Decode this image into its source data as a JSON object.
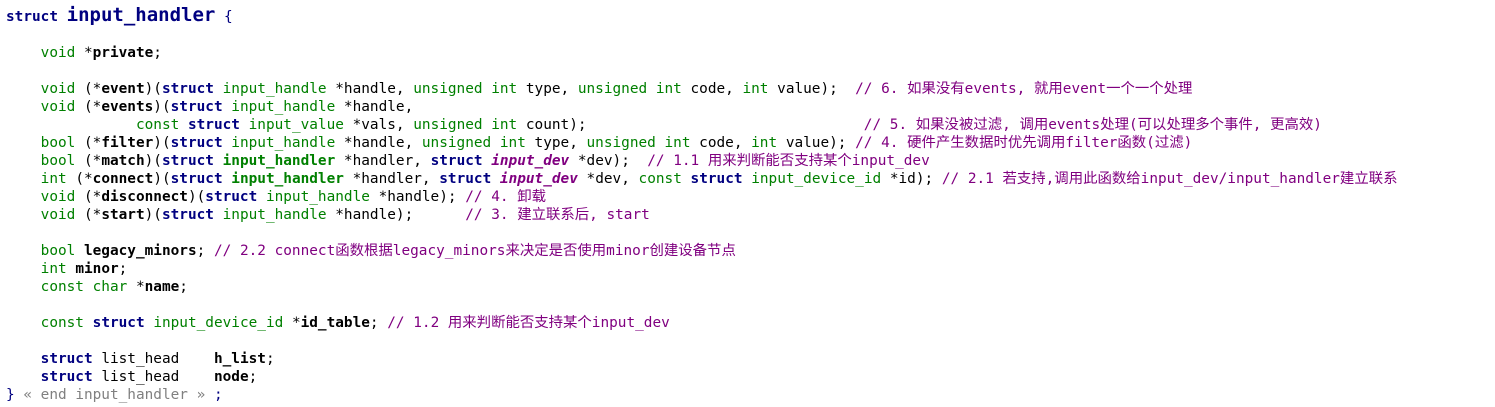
{
  "editor": {
    "lines": [
      [
        {
          "t": "struct ",
          "c": "sk"
        },
        {
          "t": "input_handler",
          "c": "title"
        },
        {
          "t": " {",
          "c": "brace"
        }
      ],
      [],
      [
        {
          "t": "    ",
          "c": "p"
        },
        {
          "t": "void",
          "c": "kw"
        },
        {
          "t": " *",
          "c": "p"
        },
        {
          "t": "private",
          "c": "fn"
        },
        {
          "t": ";",
          "c": "p"
        }
      ],
      [],
      [
        {
          "t": "    ",
          "c": "p"
        },
        {
          "t": "void",
          "c": "kw"
        },
        {
          "t": " (*",
          "c": "p"
        },
        {
          "t": "event",
          "c": "fn"
        },
        {
          "t": ")(",
          "c": "p"
        },
        {
          "t": "struct",
          "c": "sk"
        },
        {
          "t": " ",
          "c": "p"
        },
        {
          "t": "input_handle",
          "c": "ty"
        },
        {
          "t": " *",
          "c": "p"
        },
        {
          "t": "handle",
          "c": "id"
        },
        {
          "t": ", ",
          "c": "p"
        },
        {
          "t": "unsigned int",
          "c": "kw"
        },
        {
          "t": " ",
          "c": "p"
        },
        {
          "t": "type",
          "c": "id"
        },
        {
          "t": ", ",
          "c": "p"
        },
        {
          "t": "unsigned int",
          "c": "kw"
        },
        {
          "t": " ",
          "c": "p"
        },
        {
          "t": "code",
          "c": "id"
        },
        {
          "t": ", ",
          "c": "p"
        },
        {
          "t": "int",
          "c": "kw"
        },
        {
          "t": " ",
          "c": "p"
        },
        {
          "t": "value",
          "c": "id"
        },
        {
          "t": ");  ",
          "c": "p"
        },
        {
          "t": "// 6. 如果没有events, 就用event一个一个处理",
          "c": "cm"
        }
      ],
      [
        {
          "t": "    ",
          "c": "p"
        },
        {
          "t": "void",
          "c": "kw"
        },
        {
          "t": " (*",
          "c": "p"
        },
        {
          "t": "events",
          "c": "fn"
        },
        {
          "t": ")(",
          "c": "p"
        },
        {
          "t": "struct",
          "c": "sk"
        },
        {
          "t": " ",
          "c": "p"
        },
        {
          "t": "input_handle",
          "c": "ty"
        },
        {
          "t": " *",
          "c": "p"
        },
        {
          "t": "handle",
          "c": "id"
        },
        {
          "t": ",",
          "c": "p"
        }
      ],
      [
        {
          "t": "               ",
          "c": "p"
        },
        {
          "t": "const",
          "c": "kw"
        },
        {
          "t": " ",
          "c": "p"
        },
        {
          "t": "struct",
          "c": "sk"
        },
        {
          "t": " ",
          "c": "p"
        },
        {
          "t": "input_value",
          "c": "ty"
        },
        {
          "t": " *",
          "c": "p"
        },
        {
          "t": "vals",
          "c": "id"
        },
        {
          "t": ", ",
          "c": "p"
        },
        {
          "t": "unsigned int",
          "c": "kw"
        },
        {
          "t": " ",
          "c": "p"
        },
        {
          "t": "count",
          "c": "id"
        },
        {
          "t": ");                                ",
          "c": "p"
        },
        {
          "t": "// 5. 如果没被过滤, 调用events处理(可以处理多个事件, 更高效)",
          "c": "cm"
        }
      ],
      [
        {
          "t": "    ",
          "c": "p"
        },
        {
          "t": "bool",
          "c": "kw"
        },
        {
          "t": " (*",
          "c": "p"
        },
        {
          "t": "filter",
          "c": "fn"
        },
        {
          "t": ")(",
          "c": "p"
        },
        {
          "t": "struct",
          "c": "sk"
        },
        {
          "t": " ",
          "c": "p"
        },
        {
          "t": "input_handle",
          "c": "ty"
        },
        {
          "t": " *",
          "c": "p"
        },
        {
          "t": "handle",
          "c": "id"
        },
        {
          "t": ", ",
          "c": "p"
        },
        {
          "t": "unsigned int",
          "c": "kw"
        },
        {
          "t": " ",
          "c": "p"
        },
        {
          "t": "type",
          "c": "id"
        },
        {
          "t": ", ",
          "c": "p"
        },
        {
          "t": "unsigned int",
          "c": "kw"
        },
        {
          "t": " ",
          "c": "p"
        },
        {
          "t": "code",
          "c": "id"
        },
        {
          "t": ", ",
          "c": "p"
        },
        {
          "t": "int",
          "c": "kw"
        },
        {
          "t": " ",
          "c": "p"
        },
        {
          "t": "value",
          "c": "id"
        },
        {
          "t": "); ",
          "c": "p"
        },
        {
          "t": "// 4. 硬件产生数据时优先调用filter函数(过滤)",
          "c": "cm"
        }
      ],
      [
        {
          "t": "    ",
          "c": "p"
        },
        {
          "t": "bool",
          "c": "kw"
        },
        {
          "t": " (*",
          "c": "p"
        },
        {
          "t": "match",
          "c": "fn"
        },
        {
          "t": ")(",
          "c": "p"
        },
        {
          "t": "struct",
          "c": "sk"
        },
        {
          "t": " ",
          "c": "p"
        },
        {
          "t": "input_handler",
          "c": "tyb"
        },
        {
          "t": " *",
          "c": "p"
        },
        {
          "t": "handler",
          "c": "id"
        },
        {
          "t": ", ",
          "c": "p"
        },
        {
          "t": "struct",
          "c": "sk"
        },
        {
          "t": " ",
          "c": "p"
        },
        {
          "t": "input_dev",
          "c": "tyi"
        },
        {
          "t": " *",
          "c": "p"
        },
        {
          "t": "dev",
          "c": "id"
        },
        {
          "t": ");  ",
          "c": "p"
        },
        {
          "t": "// 1.1 用来判断能否支持某个input_dev",
          "c": "cm"
        }
      ],
      [
        {
          "t": "    ",
          "c": "p"
        },
        {
          "t": "int",
          "c": "kw"
        },
        {
          "t": " (*",
          "c": "p"
        },
        {
          "t": "connect",
          "c": "fn"
        },
        {
          "t": ")(",
          "c": "p"
        },
        {
          "t": "struct",
          "c": "sk"
        },
        {
          "t": " ",
          "c": "p"
        },
        {
          "t": "input_handler",
          "c": "tyb"
        },
        {
          "t": " *",
          "c": "p"
        },
        {
          "t": "handler",
          "c": "id"
        },
        {
          "t": ", ",
          "c": "p"
        },
        {
          "t": "struct",
          "c": "sk"
        },
        {
          "t": " ",
          "c": "p"
        },
        {
          "t": "input_dev",
          "c": "tyi"
        },
        {
          "t": " *",
          "c": "p"
        },
        {
          "t": "dev",
          "c": "id"
        },
        {
          "t": ", ",
          "c": "p"
        },
        {
          "t": "const",
          "c": "kw"
        },
        {
          "t": " ",
          "c": "p"
        },
        {
          "t": "struct",
          "c": "sk"
        },
        {
          "t": " ",
          "c": "p"
        },
        {
          "t": "input_device_id",
          "c": "ty"
        },
        {
          "t": " *",
          "c": "p"
        },
        {
          "t": "id",
          "c": "id"
        },
        {
          "t": "); ",
          "c": "p"
        },
        {
          "t": "// 2.1 若支持,调用此函数给input_dev/input_handler建立联系",
          "c": "cm"
        }
      ],
      [
        {
          "t": "    ",
          "c": "p"
        },
        {
          "t": "void",
          "c": "kw"
        },
        {
          "t": " (*",
          "c": "p"
        },
        {
          "t": "disconnect",
          "c": "fn"
        },
        {
          "t": ")(",
          "c": "p"
        },
        {
          "t": "struct",
          "c": "sk"
        },
        {
          "t": " ",
          "c": "p"
        },
        {
          "t": "input_handle",
          "c": "ty"
        },
        {
          "t": " *",
          "c": "p"
        },
        {
          "t": "handle",
          "c": "id"
        },
        {
          "t": "); ",
          "c": "p"
        },
        {
          "t": "// 4. 卸载",
          "c": "cm"
        }
      ],
      [
        {
          "t": "    ",
          "c": "p"
        },
        {
          "t": "void",
          "c": "kw"
        },
        {
          "t": " (*",
          "c": "p"
        },
        {
          "t": "start",
          "c": "fn"
        },
        {
          "t": ")(",
          "c": "p"
        },
        {
          "t": "struct",
          "c": "sk"
        },
        {
          "t": " ",
          "c": "p"
        },
        {
          "t": "input_handle",
          "c": "ty"
        },
        {
          "t": " *",
          "c": "p"
        },
        {
          "t": "handle",
          "c": "id"
        },
        {
          "t": ");      ",
          "c": "p"
        },
        {
          "t": "// 3. 建立联系后, start",
          "c": "cm"
        }
      ],
      [],
      [
        {
          "t": "    ",
          "c": "p"
        },
        {
          "t": "bool",
          "c": "kw"
        },
        {
          "t": " ",
          "c": "p"
        },
        {
          "t": "legacy_minors",
          "c": "fn"
        },
        {
          "t": "; ",
          "c": "p"
        },
        {
          "t": "// 2.2 connect函数根据legacy_minors来决定是否使用minor创建设备节点",
          "c": "cm"
        }
      ],
      [
        {
          "t": "    ",
          "c": "p"
        },
        {
          "t": "int",
          "c": "kw"
        },
        {
          "t": " ",
          "c": "p"
        },
        {
          "t": "minor",
          "c": "fn"
        },
        {
          "t": ";",
          "c": "p"
        }
      ],
      [
        {
          "t": "    ",
          "c": "p"
        },
        {
          "t": "const char",
          "c": "kw"
        },
        {
          "t": " *",
          "c": "p"
        },
        {
          "t": "name",
          "c": "fn"
        },
        {
          "t": ";",
          "c": "p"
        }
      ],
      [],
      [
        {
          "t": "    ",
          "c": "p"
        },
        {
          "t": "const",
          "c": "kw"
        },
        {
          "t": " ",
          "c": "p"
        },
        {
          "t": "struct",
          "c": "sk"
        },
        {
          "t": " ",
          "c": "p"
        },
        {
          "t": "input_device_id",
          "c": "ty"
        },
        {
          "t": " *",
          "c": "p"
        },
        {
          "t": "id_table",
          "c": "fn"
        },
        {
          "t": "; ",
          "c": "p"
        },
        {
          "t": "// 1.2 用来判断能否支持某个input_dev",
          "c": "cm"
        }
      ],
      [],
      [
        {
          "t": "    ",
          "c": "p"
        },
        {
          "t": "struct",
          "c": "sk"
        },
        {
          "t": " ",
          "c": "p"
        },
        {
          "t": "list_head",
          "c": "id"
        },
        {
          "t": "    ",
          "c": "p"
        },
        {
          "t": "h_list",
          "c": "fn"
        },
        {
          "t": ";",
          "c": "p"
        }
      ],
      [
        {
          "t": "    ",
          "c": "p"
        },
        {
          "t": "struct",
          "c": "sk"
        },
        {
          "t": " ",
          "c": "p"
        },
        {
          "t": "list_head",
          "c": "id"
        },
        {
          "t": "    ",
          "c": "p"
        },
        {
          "t": "node",
          "c": "fn"
        },
        {
          "t": ";",
          "c": "p"
        }
      ],
      [
        {
          "t": "}",
          "c": "brace"
        },
        {
          "t": " « end input_handler » ",
          "c": "cmt"
        },
        {
          "t": ";",
          "c": "brace"
        }
      ]
    ]
  }
}
